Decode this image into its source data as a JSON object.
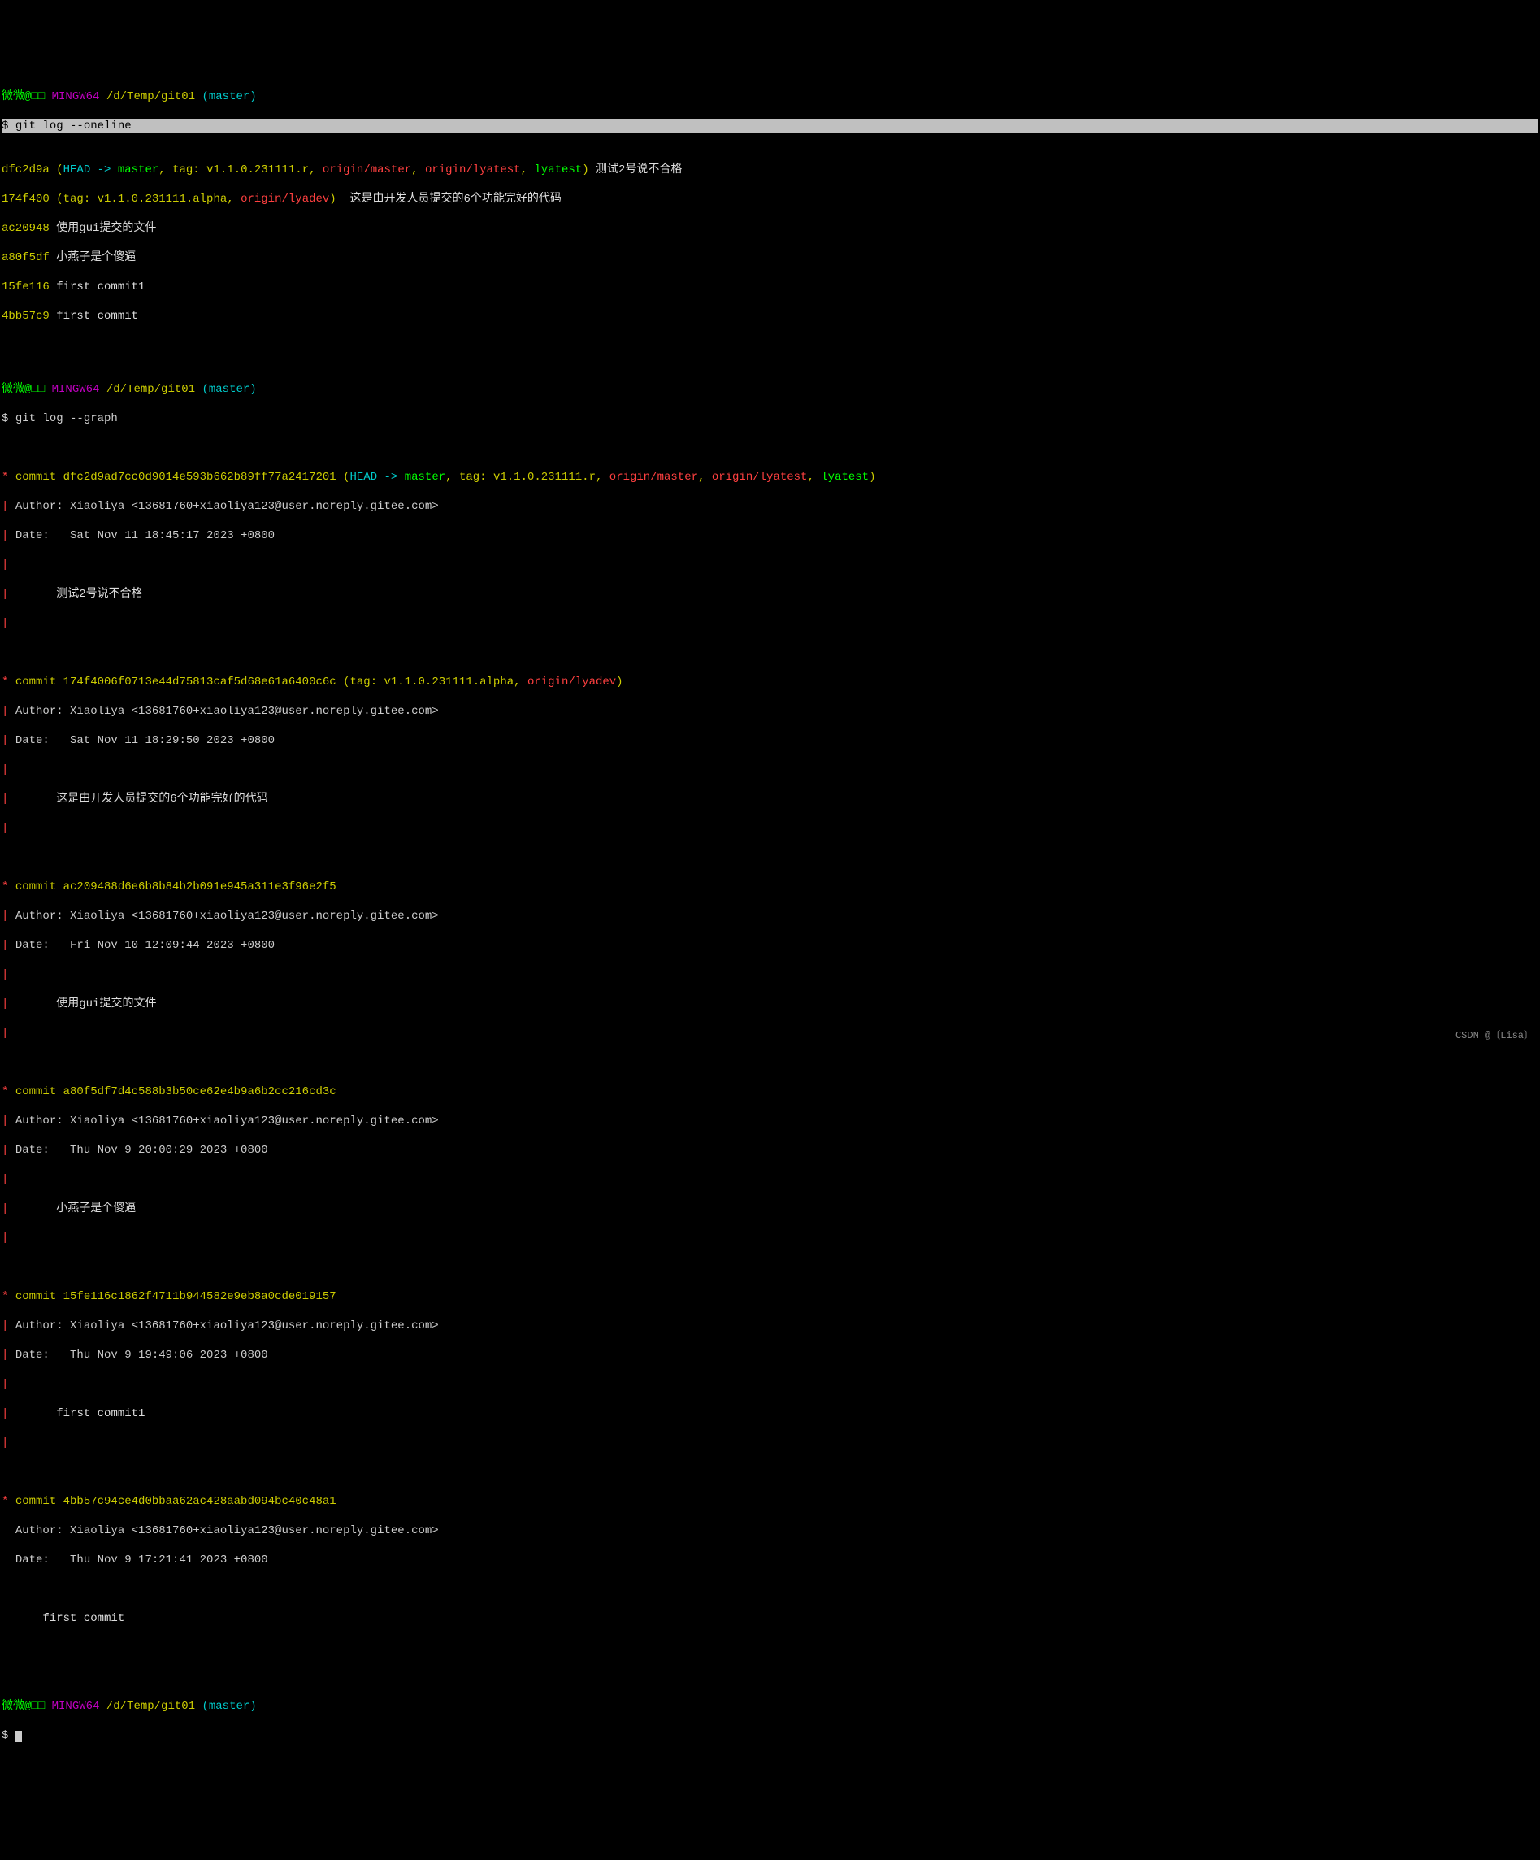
{
  "prompt": {
    "user_host": "微微@□□",
    "env": "MINGW64",
    "path": "/d/Temp/git01",
    "branch": "(master)",
    "ps1": "$ "
  },
  "cmd1": "git log --oneline",
  "oneline": [
    {
      "hash": "dfc2d9a",
      "refs_open": "(",
      "head": "HEAD -> ",
      "master": "master",
      "sep1": ", ",
      "tag": "tag: v1.1.0.231111.r",
      "sep2": ", ",
      "om": "origin/master",
      "sep3": ", ",
      "ol": "origin/lyatest",
      "sep4": ", ",
      "lb": "lyatest",
      "refs_close": ")",
      "msg": " 测试2号说不合格"
    },
    {
      "hash": "174f400",
      "refs_open": " (",
      "tag": "tag: v1.1.0.231111.alpha",
      "sep": ", ",
      "rb": "origin/lyadev",
      "refs_close": ")",
      "msg": "  这是由开发人员提交的6个功能完好的代码"
    },
    {
      "hash": "ac20948",
      "msg": " 使用gui提交的文件"
    },
    {
      "hash": "a80f5df",
      "msg": " 小燕子是个傻逼"
    },
    {
      "hash": "15fe116",
      "msg": " first commit1"
    },
    {
      "hash": "4bb57c9",
      "msg": " first commit"
    }
  ],
  "cmd2": "git log --graph",
  "graph": [
    {
      "hash": "dfc2d9ad7cc0d9014e593b662b89ff77a2417201",
      "refs": {
        "open": "(",
        "head": "HEAD -> ",
        "master": "master",
        "s1": ", ",
        "tag": "tag: v1.1.0.231111.r",
        "s2": ", ",
        "om": "origin/master",
        "s3": ", ",
        "ol": "origin/lyatest",
        "s4": ", ",
        "lb": "lyatest",
        "close": ")"
      },
      "author": "Author: Xiaoliya <13681760+xiaoliya123@user.noreply.gitee.com>",
      "date": "Date:   Sat Nov 11 18:45:17 2023 +0800",
      "msg": "测试2号说不合格"
    },
    {
      "hash": "174f4006f0713e44d75813caf5d68e61a6400c6c",
      "refs": {
        "open": "(",
        "tag": "tag: v1.1.0.231111.alpha",
        "s1": ", ",
        "rb": "origin/lyadev",
        "close": ")"
      },
      "author": "Author: Xiaoliya <13681760+xiaoliya123@user.noreply.gitee.com>",
      "date": "Date:   Sat Nov 11 18:29:50 2023 +0800",
      "msg": "这是由开发人员提交的6个功能完好的代码"
    },
    {
      "hash": "ac209488d6e6b8b84b2b091e945a311e3f96e2f5",
      "author": "Author: Xiaoliya <13681760+xiaoliya123@user.noreply.gitee.com>",
      "date": "Date:   Fri Nov 10 12:09:44 2023 +0800",
      "msg": "使用gui提交的文件"
    },
    {
      "hash": "a80f5df7d4c588b3b50ce62e4b9a6b2cc216cd3c",
      "author": "Author: Xiaoliya <13681760+xiaoliya123@user.noreply.gitee.com>",
      "date": "Date:   Thu Nov 9 20:00:29 2023 +0800",
      "msg": "小燕子是个傻逼"
    },
    {
      "hash": "15fe116c1862f4711b944582e9eb8a0cde019157",
      "author": "Author: Xiaoliya <13681760+xiaoliya123@user.noreply.gitee.com>",
      "date": "Date:   Thu Nov 9 19:49:06 2023 +0800",
      "msg": "first commit1"
    },
    {
      "hash": "4bb57c94ce4d0bbaa62ac428aabd094bc40c48a1",
      "author": "Author: Xiaoliya <13681760+xiaoliya123@user.noreply.gitee.com>",
      "date": "Date:   Thu Nov 9 17:21:41 2023 +0800",
      "msg": "first commit"
    }
  ],
  "graph_tokens": {
    "star": "* ",
    "pipe": "| ",
    "commit_word": "commit ",
    "indent": "      "
  },
  "watermark": "CSDN @〔Lisa〕"
}
